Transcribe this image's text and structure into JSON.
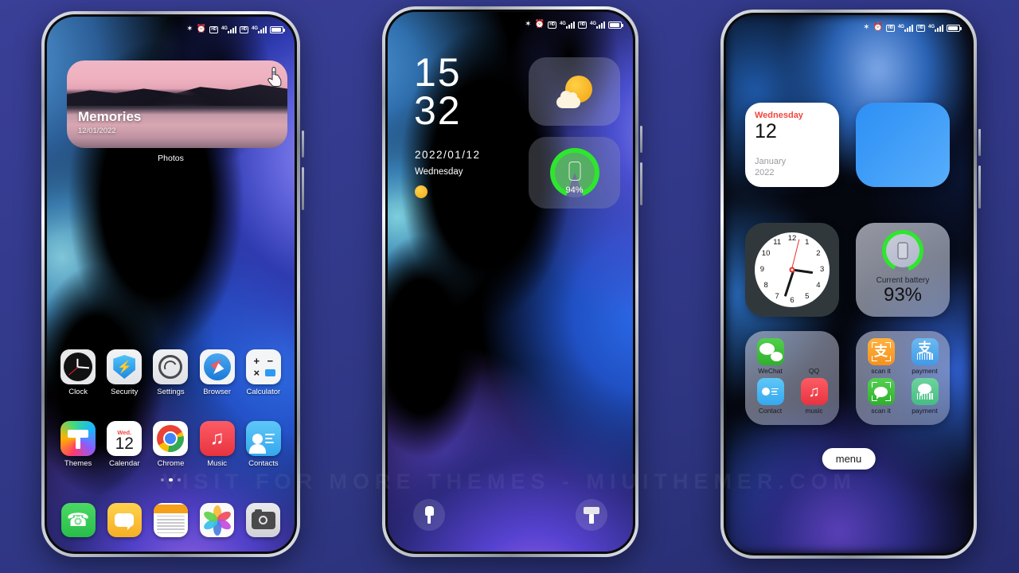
{
  "watermark": "VISIT FOR MORE THEMES - MIUITHEMER.COM",
  "status_bar": {
    "bluetooth_icon": "bluetooth-icon",
    "alarm_icon": "alarm-icon",
    "sim1_label": "HD",
    "sim1_network": "4G",
    "sim2_label": "HD",
    "sim2_network": "4G",
    "battery_icon": "battery-icon"
  },
  "phone1": {
    "name": "Home screen",
    "widget": {
      "title": "Memories",
      "date": "12/01/2022",
      "app_label": "Photos"
    },
    "apps_row1": [
      {
        "label": "Clock",
        "icon": "clock-icon"
      },
      {
        "label": "Security",
        "icon": "security-shield-icon"
      },
      {
        "label": "Settings",
        "icon": "settings-gear-icon"
      },
      {
        "label": "Browser",
        "icon": "browser-compass-icon"
      },
      {
        "label": "Calculator",
        "icon": "calculator-icon"
      }
    ],
    "apps_row2": [
      {
        "label": "Themes",
        "icon": "themes-brush-icon"
      },
      {
        "label": "Calendar",
        "icon": "calendar-icon",
        "weekday": "Wed.",
        "day": "12"
      },
      {
        "label": "Chrome",
        "icon": "chrome-icon"
      },
      {
        "label": "Music",
        "icon": "music-note-icon"
      },
      {
        "label": "Contacts",
        "icon": "contacts-icon"
      }
    ],
    "dock": [
      {
        "label": "Phone",
        "icon": "phone-handset-icon"
      },
      {
        "label": "Messages",
        "icon": "messages-bubble-icon"
      },
      {
        "label": "Notes",
        "icon": "notes-icon"
      },
      {
        "label": "Photos",
        "icon": "photos-flower-icon"
      },
      {
        "label": "Camera",
        "icon": "camera-icon"
      }
    ],
    "page_dots": 3,
    "active_dot": 1,
    "cursor_icon": "tap-hand-cursor"
  },
  "phone2": {
    "name": "Lock screen",
    "time_hour": "15",
    "time_minute": "32",
    "date": "2022/01/12",
    "weekday": "Wednesday",
    "weather_icon": "sun-behind-cloud-icon",
    "battery_percent": "94%",
    "battery_ring_color": "#2ee62e",
    "shortcut_left_icon": "flashlight-icon",
    "shortcut_right_icon": "brush-icon"
  },
  "phone3": {
    "name": "Widgets screen",
    "calendar_widget": {
      "weekday": "Wednesday",
      "day": "12",
      "month": "January",
      "year": "2022",
      "weekday_color": "#f2453d"
    },
    "blue_widget": {
      "icon": "blank-blue-widget",
      "color": "#3d9bf7"
    },
    "clock_widget": {
      "numerals": [
        "1",
        "2",
        "3",
        "4",
        "5",
        "6",
        "7",
        "8",
        "9",
        "10",
        "11",
        "12"
      ],
      "icon": "analog-clock-icon"
    },
    "battery_widget": {
      "label": "Current battery",
      "value": "93%",
      "ring_color": "#2ee62e"
    },
    "folder_left": [
      {
        "label": "WeChat",
        "icon": "wechat-icon"
      },
      {
        "label": "QQ",
        "icon": "qq-icon"
      },
      {
        "label": "Contact",
        "icon": "contact-icon"
      },
      {
        "label": "music",
        "icon": "music-icon"
      }
    ],
    "folder_right": [
      {
        "label": "scan it",
        "icon": "alipay-scan-icon"
      },
      {
        "label": "payment",
        "icon": "alipay-payment-icon"
      },
      {
        "label": "scan it",
        "icon": "wechat-scan-icon"
      },
      {
        "label": "payment",
        "icon": "wechat-payment-icon"
      }
    ],
    "menu_label": "menu"
  }
}
